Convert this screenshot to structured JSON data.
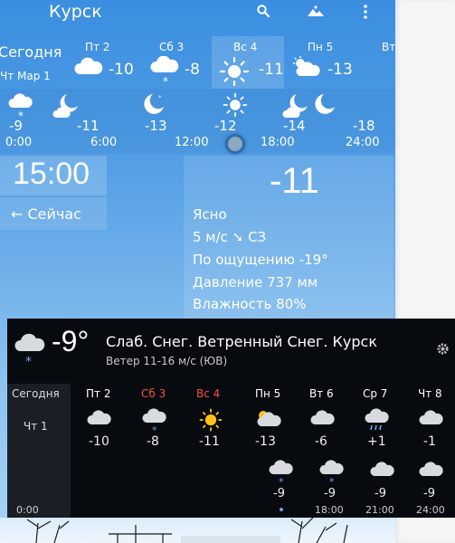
{
  "topbar": {
    "city": "Курск",
    "search_icon": "search-icon",
    "scene_icon": "landscape-icon",
    "menu_icon": "more-vert-icon"
  },
  "today": {
    "label": "Сегодня",
    "date": "Чт Мар 1"
  },
  "days": [
    {
      "name": "Пт 2",
      "temp": "-10",
      "icon": "cloud"
    },
    {
      "name": "Сб 3",
      "temp": "-8",
      "icon": "snow-cloud"
    },
    {
      "name": "Вс 4",
      "temp": "-11",
      "icon": "sun"
    },
    {
      "name": "Пн 5",
      "temp": "-13",
      "icon": "partly-cloudy"
    },
    {
      "name": "Вт",
      "temp": "",
      "icon": ""
    }
  ],
  "hourly": {
    "temps": [
      "-9",
      "-11",
      "-13",
      "-12",
      "-14",
      "-18"
    ],
    "times": [
      "0:00",
      "6:00",
      "12:00",
      "18:00",
      "24:00"
    ],
    "icons": [
      "snow-cloud",
      "moon-cloud",
      "moon",
      "sun",
      "moon-cloud",
      "moon"
    ]
  },
  "selected_time": "15:00",
  "now_button": "← Сейчас",
  "detail": {
    "temp": "-11",
    "condition": "Ясно",
    "wind": "5 м/с",
    "wind_arrow": "➘",
    "wind_dir": "СЗ",
    "feels_like": "По ощущению -19°",
    "pressure": "Давление 737 мм",
    "humidity": "Влажность 80%"
  },
  "widget": {
    "temp": "-9°",
    "condition": "Слаб. Снег. Ветренный Снег. Курск",
    "wind": "Ветер 11-16 м/с (ЮВ)",
    "today": "Сегодня",
    "today_date": "Чт 1",
    "days": [
      {
        "name": "Пт 2",
        "temp": "-10",
        "icon": "cloud",
        "color": "#ffffff"
      },
      {
        "name": "Сб 3",
        "temp": "-8",
        "icon": "snow-cloud",
        "color": "#ff4a3d"
      },
      {
        "name": "Вс 4",
        "temp": "-11",
        "icon": "sun",
        "color": "#ff4a3d"
      },
      {
        "name": "Пн 5",
        "temp": "-13",
        "icon": "partly-cloudy",
        "color": "#ffffff"
      },
      {
        "name": "Вт 6",
        "temp": "-6",
        "icon": "cloud",
        "color": "#ffffff"
      },
      {
        "name": "Ср 7",
        "temp": "+1",
        "icon": "rain-cloud",
        "color": "#ffffff"
      },
      {
        "name": "Чт 8",
        "temp": "-1",
        "icon": "cloud",
        "color": "#ffffff"
      }
    ],
    "hourly": [
      {
        "temp": "-9",
        "time": "",
        "icon": "snow-cloud"
      },
      {
        "temp": "-9",
        "time": "18:00",
        "icon": "snow-cloud"
      },
      {
        "temp": "-9",
        "time": "21:00",
        "icon": "cloud"
      },
      {
        "temp": "-9",
        "time": "24:00",
        "icon": "cloud"
      }
    ],
    "hour_start": "0:00"
  },
  "colors": {
    "sky_top": "#3b8ee0",
    "widget_bg": "#070a0f",
    "weekend_red": "#ff4a3d",
    "knob_ring": "#2c6fb0"
  }
}
